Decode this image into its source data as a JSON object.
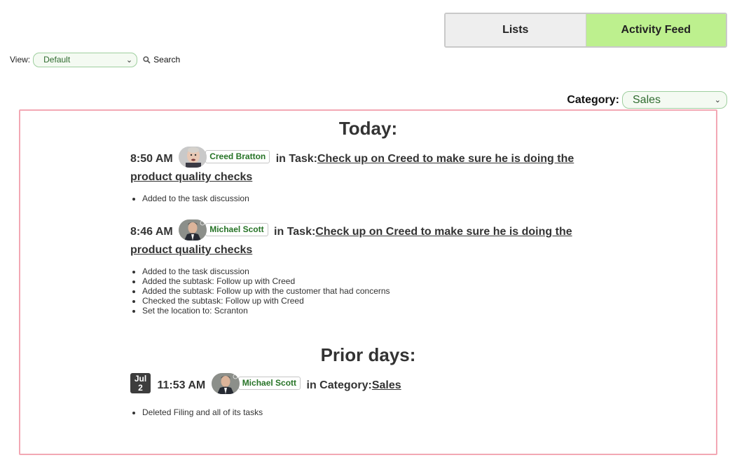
{
  "tabs": {
    "lists": "Lists",
    "activity_feed": "Activity Feed"
  },
  "view": {
    "label": "View:",
    "selected": "Default",
    "search_label": "Search"
  },
  "category": {
    "label": "Category:",
    "selected": "Sales"
  },
  "feed": {
    "today_heading": "Today:",
    "prior_heading": "Prior days:",
    "entries": [
      {
        "time": "8:50 AM",
        "user": "Creed Bratton",
        "context": "in Task:",
        "link": "Check up on Creed to make sure he is doing the product quality checks",
        "details": [
          "Added to the task discussion"
        ]
      },
      {
        "time": "8:46 AM",
        "user": "Michael Scott",
        "context": "in Task:",
        "link": "Check up on Creed to make sure he is doing the product quality checks",
        "details": [
          "Added to the task discussion",
          "Added the subtask: Follow up with Creed",
          "Added the subtask: Follow up with the customer that had concerns",
          "Checked the subtask: Follow up with Creed",
          "Set the location to: Scranton"
        ]
      }
    ],
    "prior_entries": [
      {
        "date_month": "Jul",
        "date_day": "2",
        "time": "11:53 AM",
        "user": "Michael Scott",
        "context": "in Category:",
        "link": "Sales",
        "details": [
          "Deleted Filing and all of its tasks"
        ]
      }
    ]
  },
  "colors": {
    "active_tab": "#bdf08e",
    "inactive_tab": "#eeeeee",
    "feed_border": "#f3a8b4",
    "user_name": "#267326"
  },
  "icons": {
    "search": "search-icon",
    "dropdown": "chevron-down-icon",
    "avatar": "avatar"
  }
}
